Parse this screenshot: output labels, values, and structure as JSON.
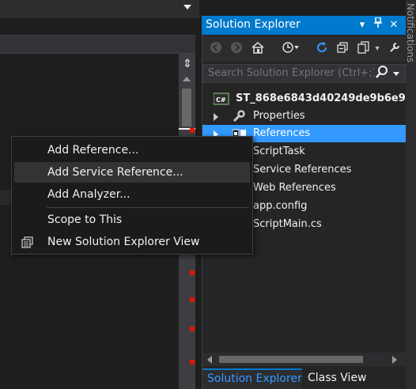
{
  "colors": {
    "accent": "#007acc",
    "selection": "#3399ff",
    "background": "#1e1e1e",
    "marker": "#e51400"
  },
  "solution_explorer": {
    "title": "Solution Explorer",
    "title_buttons": [
      {
        "name": "dropdown-arrow-icon",
        "glyph": "▾"
      },
      {
        "name": "pin-icon",
        "glyph": "📌"
      },
      {
        "name": "close-icon",
        "glyph": "✕"
      }
    ],
    "toolbar": [
      {
        "name": "back-icon",
        "glyph": "←"
      },
      {
        "name": "forward-icon",
        "glyph": "→"
      },
      {
        "name": "home-icon",
        "glyph": "⌂"
      },
      {
        "name": "pending-changes-filter-icon",
        "glyph": "⏱"
      },
      {
        "name": "refresh-icon",
        "glyph": "↻"
      },
      {
        "name": "collapse-all-icon",
        "glyph": "⧉"
      },
      {
        "name": "show-all-files-icon",
        "glyph": "⎘"
      }
    ],
    "search_placeholder": "Search Solution Explorer (Ctrl+;)",
    "tree": [
      {
        "label": "ST_868e6843d40249de9b6e9e",
        "bold": true,
        "icon": "csharp-project-icon",
        "expander": false,
        "selected": false
      },
      {
        "label": "Properties",
        "bold": false,
        "icon": "wrench-icon",
        "expander": true,
        "selected": false
      },
      {
        "label": "References",
        "bold": false,
        "icon": "references-icon",
        "expander": true,
        "selected": true
      },
      {
        "label": "ScriptTask",
        "bold": false,
        "icon": "file-icon",
        "expander": false,
        "selected": false
      },
      {
        "label": "Service References",
        "bold": false,
        "icon": "folder-icon",
        "expander": false,
        "selected": false
      },
      {
        "label": "Web References",
        "bold": false,
        "icon": "folder-icon",
        "expander": false,
        "selected": false
      },
      {
        "label": "app.config",
        "bold": false,
        "icon": "config-file-icon",
        "expander": false,
        "selected": false
      },
      {
        "label": "ScriptMain.cs",
        "bold": false,
        "icon": "cs-file-icon",
        "expander": false,
        "selected": false
      }
    ],
    "tabs": [
      "Solution Explorer",
      "Class View"
    ]
  },
  "context_menu": {
    "items": [
      {
        "label": "Add Reference...",
        "hover": false
      },
      {
        "label": "Add Service Reference...",
        "hover": true
      },
      {
        "label": "Add Analyzer...",
        "hover": false
      },
      {
        "label": "Scope to This",
        "hover": false
      },
      {
        "label": "New Solution Explorer View",
        "hover": false
      }
    ]
  },
  "notifications_label": "Notifications",
  "icons": {
    "split": "⇕",
    "search": "⚲"
  }
}
